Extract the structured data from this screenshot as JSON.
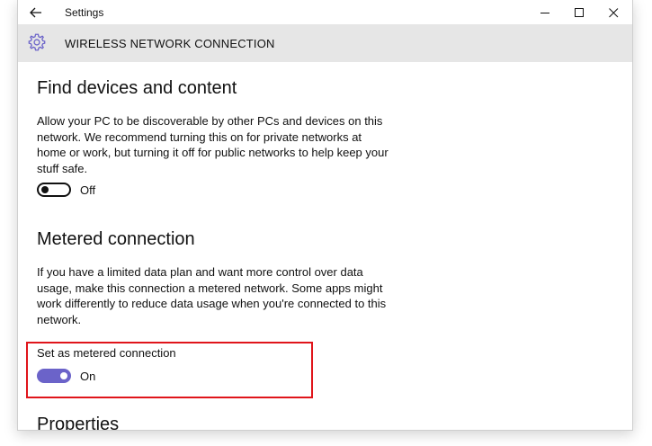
{
  "window": {
    "title": "Settings"
  },
  "header": {
    "title": "WIRELESS NETWORK CONNECTION"
  },
  "find": {
    "heading": "Find devices and content",
    "description": "Allow your PC to be discoverable by other PCs and devices on this network. We recommend turning this on for private networks at home or work, but turning it off for public networks to help keep your stuff safe.",
    "toggle_state": "Off"
  },
  "metered": {
    "heading": "Metered connection",
    "description": "If you have a limited data plan and want more control over data usage, make this connection a metered network. Some apps might work differently to reduce data usage when you're connected to this network.",
    "setting_label": "Set as metered connection",
    "toggle_state": "On"
  },
  "properties": {
    "heading": "Properties"
  },
  "colors": {
    "accent": "#6b63c9",
    "highlight": "#e0151b",
    "header_bg": "#e6e6e6"
  },
  "icons": [
    "back-arrow-icon",
    "minimize-icon",
    "maximize-icon",
    "close-icon",
    "gear-icon"
  ]
}
